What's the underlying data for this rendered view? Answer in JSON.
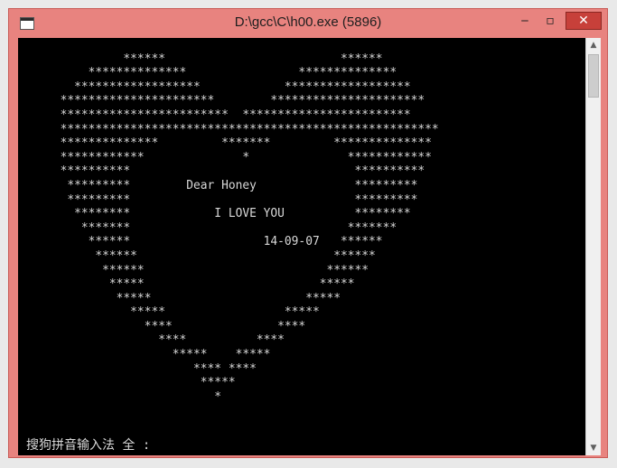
{
  "window": {
    "title": "D:\\gcc\\C\\h00.exe  (5896)",
    "minimize_label": "‒",
    "maximize_label": "▫",
    "close_label": "✕"
  },
  "console": {
    "lines": [
      "",
      "               ******                         ******",
      "          **************                **************",
      "        ******************            ******************",
      "      **********************        **********************",
      "      ************************  ************************",
      "      ******************************************************",
      "      **************         *******         **************",
      "      ************              *              ************",
      "      **********                                **********",
      "       *********        Dear Honey              *********",
      "       *********                                *********",
      "        ********            I LOVE YOU          ********",
      "         *******                               *******",
      "          ******                   14-09-07   ******",
      "           ******                            ******",
      "            ******                          ******",
      "             *****                         *****",
      "              *****                      *****",
      "                *****                 *****",
      "                  ****               ****",
      "                    ****          ****",
      "                      *****    *****",
      "                         **** ****",
      "                          *****",
      "                            *"
    ],
    "ime_status": "搜狗拼音输入法 全 :"
  },
  "scrollbar": {
    "up_label": "▲",
    "down_label": "▼"
  },
  "colors": {
    "frame": "#e8837f",
    "close_button": "#c7403a",
    "console_bg": "#000000",
    "console_text": "#d8d8d8"
  }
}
